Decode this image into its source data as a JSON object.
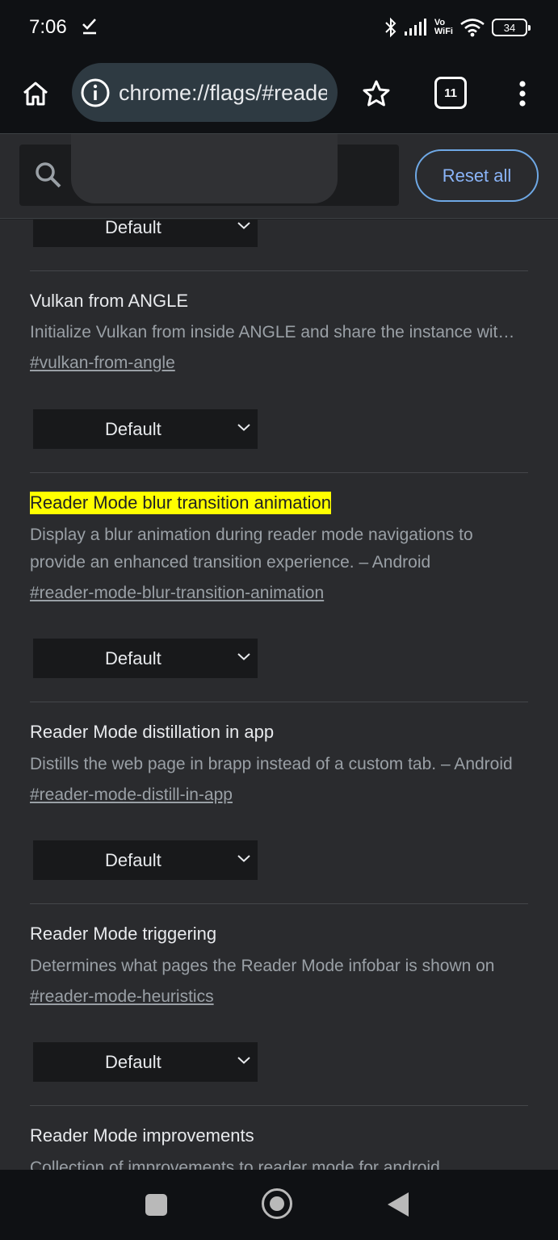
{
  "status_bar": {
    "time": "7:06",
    "network_label_top": "Vo",
    "network_label_bottom": "WiFi",
    "battery": "34"
  },
  "toolbar": {
    "url": "chrome://flags/#reader-mode",
    "tab_count": "11"
  },
  "header": {
    "search_value": "",
    "reset_label": "Reset all"
  },
  "flags": [
    {
      "title": "",
      "description": "",
      "link": "",
      "select_value": "Default"
    },
    {
      "title": "Vulkan from ANGLE",
      "description": "Initialize Vulkan from inside ANGLE and share the instance with Chrome",
      "link": "#vulkan-from-angle",
      "select_value": "Default"
    },
    {
      "title": "Reader Mode blur transition animation",
      "description": "Display a blur animation during reader mode navigations to provide an enhanced transition experience. – Android",
      "link": "#reader-mode-blur-transition-animation",
      "select_value": "Default",
      "highlight_color": "#ffff00"
    },
    {
      "title": "Reader Mode distillation in app",
      "description": "Distills the web page in brapp instead of a custom tab. – Android",
      "link": "#reader-mode-distill-in-app",
      "select_value": "Default"
    },
    {
      "title": "Reader Mode triggering",
      "description": "Determines what pages the Reader Mode infobar is shown on",
      "link": "#reader-mode-heuristics",
      "select_value": "Default"
    },
    {
      "title": "Reader Mode improvements",
      "description": "Collection of improvements to reader mode for android",
      "link": "",
      "select_value": ""
    }
  ],
  "colors": {
    "background": "#2a2b2e",
    "accent": "#8ab4f8",
    "highlight": "#ffff00"
  }
}
